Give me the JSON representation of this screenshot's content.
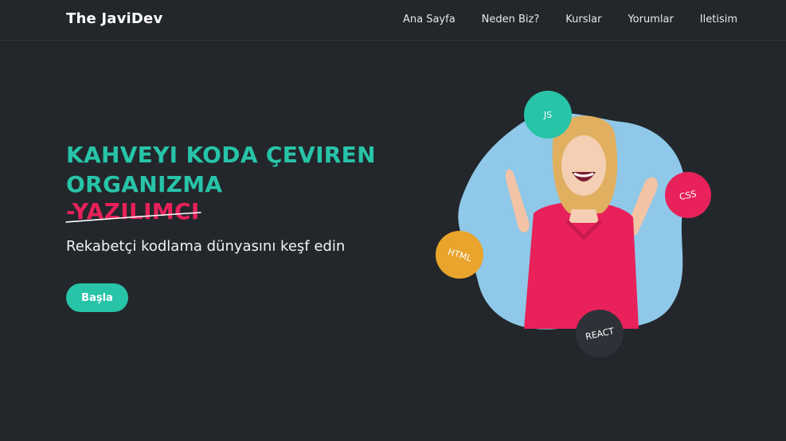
{
  "navbar": {
    "logo": "The JaviDev",
    "links": [
      "Ana Sayfa",
      "Neden Biz?",
      "Kurslar",
      "Yorumlar",
      "Iletisim"
    ]
  },
  "hero": {
    "title_line1": "KAHVEYI KODA ÇEVIREN",
    "title_line2": "ORGANIZMA",
    "title_accent": "-YAZILIMCI",
    "subtitle": "Rekabetçi kodlama dünyasını keşf edin",
    "cta_label": "Başla"
  },
  "badges": {
    "js": "JS",
    "css": "CSS",
    "html": "HTML",
    "react": "REACT"
  },
  "colors": {
    "background": "#23272c",
    "accent_teal": "#27c4a8",
    "accent_pink": "#e8215a",
    "blob": "#8fc8e8",
    "badge_js": "#27c4a8",
    "badge_css": "#e8215a",
    "badge_html": "#e9a42b",
    "badge_react": "#2e3238"
  }
}
